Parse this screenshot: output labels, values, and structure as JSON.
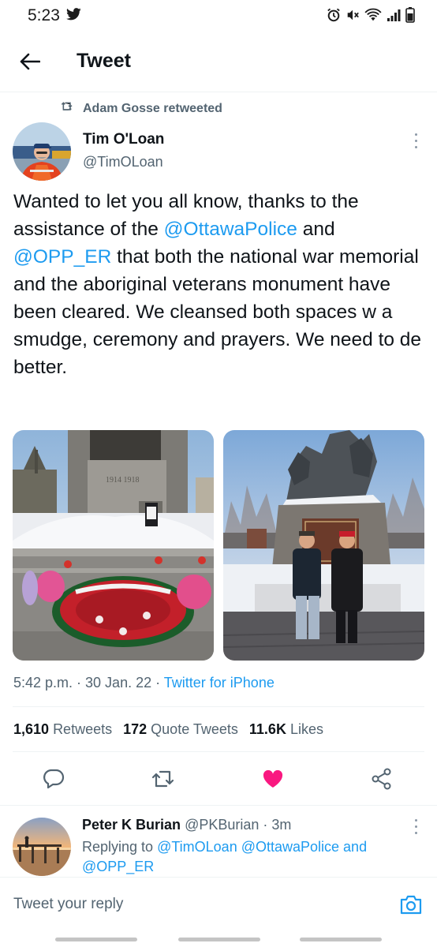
{
  "status_bar": {
    "time": "5:23",
    "left_icons": [
      "twitter-bird-icon"
    ],
    "right_icons": [
      "alarm-icon",
      "mute-icon",
      "wifi-icon",
      "signal-icon",
      "battery-icon"
    ]
  },
  "header": {
    "title": "Tweet",
    "back_icon": "arrow-left-icon"
  },
  "tweet": {
    "retweeted_by": "Adam Gosse retweeted",
    "author_name": "Tim O'Loan",
    "author_handle": "@TimOLoan",
    "text": {
      "part1": "Wanted to let you all know, thanks to the assistance of the ",
      "mention1": "@OttawaPolice",
      "part2": " and ",
      "mention2": "@OPP_ER",
      "part3": " that both the national war memorial and the aboriginal veterans monument have been cleared. We cleansed both spaces w a smudge, ceremony and prayers. We need to de better."
    },
    "media": [
      {
        "description_icon": "photo-war-memorial"
      },
      {
        "description_icon": "photo-aboriginal-veterans-monument"
      }
    ],
    "timestamp": "5:42 p.m. · 30 Jan. 22 · ",
    "source": "Twitter for iPhone",
    "stats": {
      "retweets_count": "1,610",
      "retweets_label": "Retweets",
      "quotes_count": "172",
      "quotes_label": "Quote Tweets",
      "likes_count": "11.6K",
      "likes_label": "Likes"
    },
    "actions": [
      "reply-icon",
      "retweet-icon",
      "like-icon-filled",
      "share-icon"
    ],
    "liked": true
  },
  "reply": {
    "author_name": "Peter K Burian",
    "author_handle": "@PKBurian",
    "time": " · 3m",
    "replying_to_label": "Replying to ",
    "replying_to_1": "@TimOLoan",
    "replying_to_2": "@OttawaPolice",
    "replying_to_and": " and ",
    "replying_to_3": "@OPP_ER"
  },
  "compose": {
    "placeholder": "Tweet your reply",
    "camera_icon": "camera-icon"
  },
  "colors": {
    "accent": "#1d9bf0",
    "like": "#f91880",
    "secondary_text": "#536471",
    "primary_text": "#0f1419"
  }
}
